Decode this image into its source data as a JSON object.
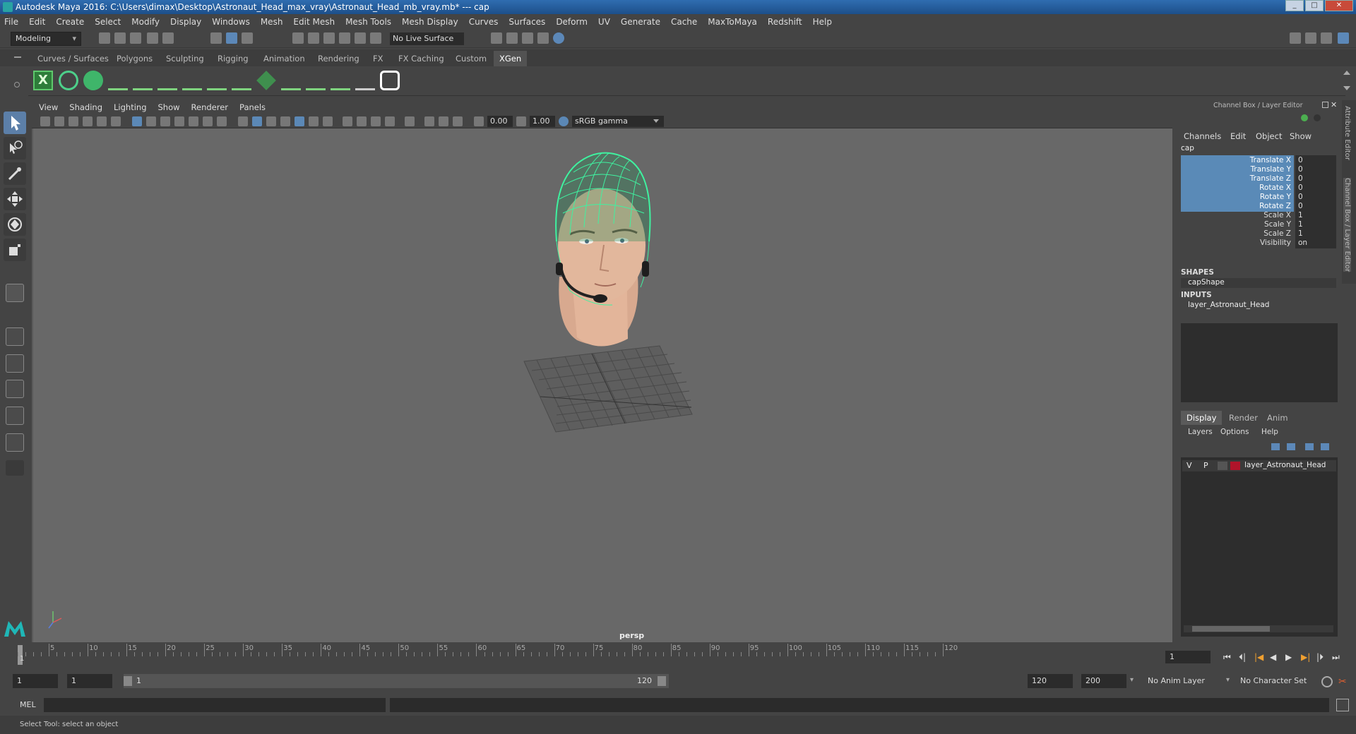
{
  "window": {
    "title": "Autodesk Maya 2016: C:\\Users\\dimax\\Desktop\\Astronaut_Head_max_vray\\Astronaut_Head_mb_vray.mb*   ---   cap"
  },
  "menubar": [
    "File",
    "Edit",
    "Create",
    "Select",
    "Modify",
    "Display",
    "Windows",
    "Mesh",
    "Edit Mesh",
    "Mesh Tools",
    "Mesh Display",
    "Curves",
    "Surfaces",
    "Deform",
    "UV",
    "Generate",
    "Cache",
    "MaxToMaya",
    "Redshift",
    "Help"
  ],
  "status_line": {
    "mode": "Modeling",
    "live_surface": "No Live Surface"
  },
  "shelf_tabs": [
    "Curves / Surfaces",
    "Polygons",
    "Sculpting",
    "Rigging",
    "Animation",
    "Rendering",
    "FX",
    "FX Caching",
    "Custom",
    "XGen"
  ],
  "shelf_active": "XGen",
  "viewport": {
    "menu": [
      "View",
      "Shading",
      "Lighting",
      "Show",
      "Renderer",
      "Panels"
    ],
    "exposure": "0.00",
    "gamma": "1.00",
    "color_space": "sRGB gamma",
    "camera_label": "persp"
  },
  "channel_box": {
    "title": "Channel Box / Layer Editor",
    "menu": [
      "Channels",
      "Edit",
      "Object",
      "Show"
    ],
    "object_name": "cap",
    "channels": [
      {
        "name": "Translate X",
        "value": "0",
        "highlight": true
      },
      {
        "name": "Translate Y",
        "value": "0",
        "highlight": true
      },
      {
        "name": "Translate Z",
        "value": "0",
        "highlight": true
      },
      {
        "name": "Rotate X",
        "value": "0",
        "highlight": true
      },
      {
        "name": "Rotate Y",
        "value": "0",
        "highlight": true
      },
      {
        "name": "Rotate Z",
        "value": "0",
        "highlight": true
      },
      {
        "name": "Scale X",
        "value": "1",
        "highlight": false
      },
      {
        "name": "Scale Y",
        "value": "1",
        "highlight": false
      },
      {
        "name": "Scale Z",
        "value": "1",
        "highlight": false
      },
      {
        "name": "Visibility",
        "value": "on",
        "highlight": false
      }
    ],
    "shapes_header": "SHAPES",
    "shape": "capShape",
    "inputs_header": "INPUTS",
    "input": "layer_Astronaut_Head"
  },
  "layer_editor": {
    "tabs": [
      "Display",
      "Render",
      "Anim"
    ],
    "active_tab": "Display",
    "menu": [
      "Layers",
      "Options",
      "Help"
    ],
    "layers": [
      {
        "v": "V",
        "p": "P",
        "name": "layer_Astronaut_Head",
        "color": "#b0142a"
      }
    ]
  },
  "side_strip": [
    "Attribute Editor",
    "Channel Box / Layer Editor"
  ],
  "timeline": {
    "ticks": [
      "5",
      "10",
      "15",
      "20",
      "25",
      "30",
      "35",
      "40",
      "45",
      "50",
      "55",
      "60",
      "65",
      "70",
      "75",
      "80",
      "85",
      "90",
      "95",
      "100",
      "105",
      "110",
      "115",
      "120"
    ],
    "current": "1",
    "current_frame_field": "1"
  },
  "range": {
    "start": "1",
    "playback_start": "1",
    "slider_start": "1",
    "slider_end": "120",
    "playback_end": "120",
    "end": "200",
    "anim_layer": "No Anim Layer",
    "character_set": "No Character Set"
  },
  "command_line": {
    "label": "MEL"
  },
  "help_line": "Select Tool: select an object",
  "colors": {
    "wireframe": "#3ff2a0",
    "highlight_channel": "#5a8ab7",
    "viewport_bg": "#686868"
  }
}
